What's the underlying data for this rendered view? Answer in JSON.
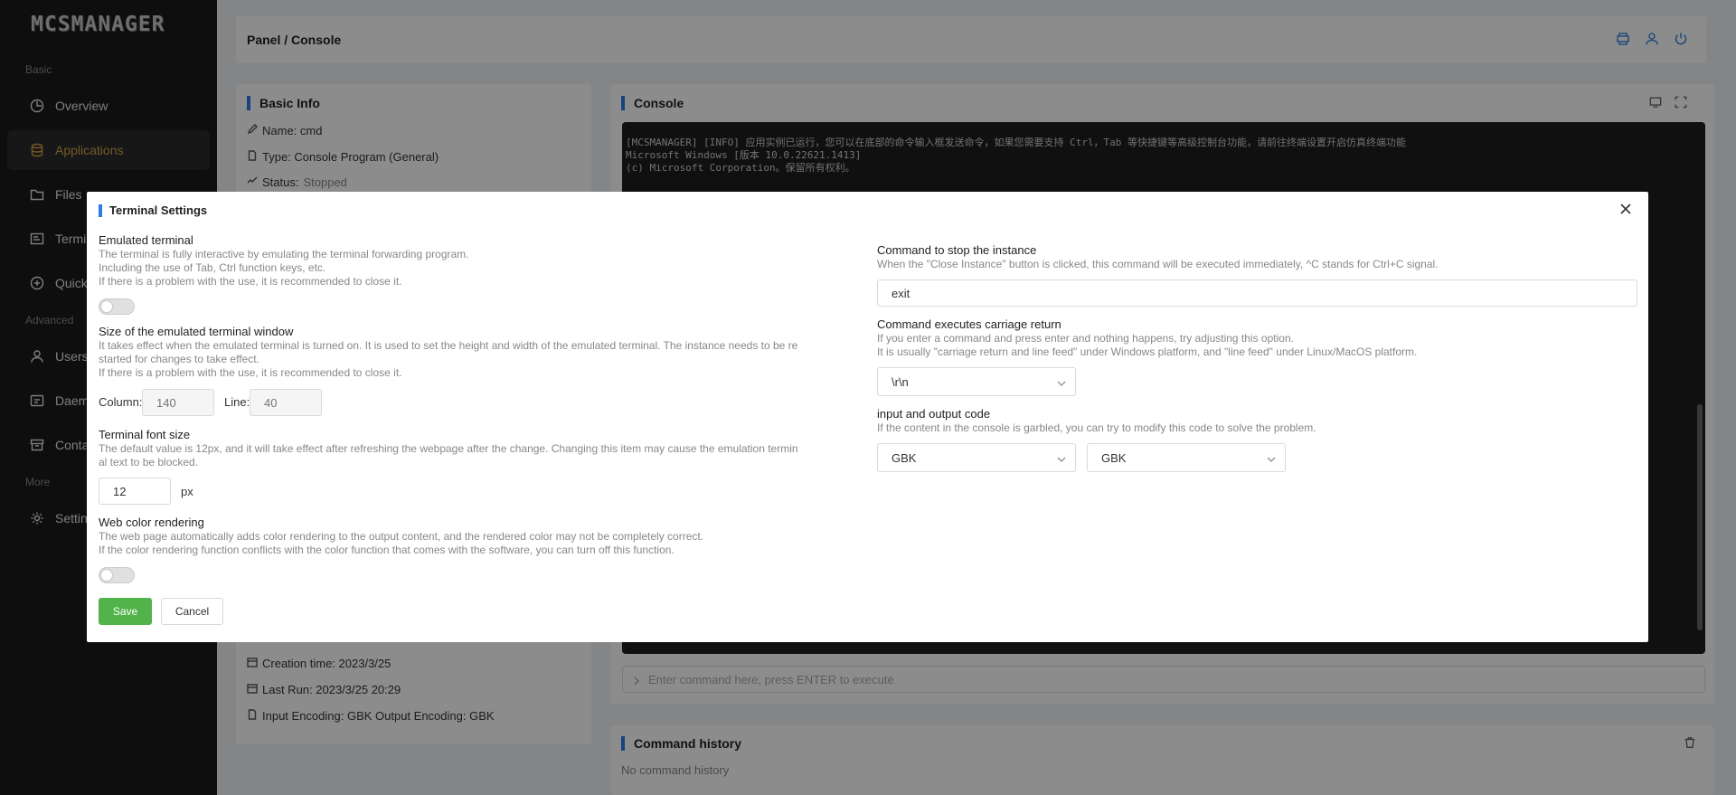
{
  "app": {
    "logo": "MCSMANAGER"
  },
  "sidebar": {
    "groups": [
      "Basic",
      "Advanced",
      "More"
    ],
    "items": [
      {
        "label": "Overview",
        "icon": "dashboard-icon"
      },
      {
        "label": "Applications",
        "icon": "database-icon",
        "active": true
      },
      {
        "label": "Files",
        "icon": "folder-icon"
      },
      {
        "label": "Termi",
        "icon": "terminal-icon"
      },
      {
        "label": "Quick",
        "icon": "plus-circle-icon"
      },
      {
        "label": "Users",
        "icon": "user-icon"
      },
      {
        "label": "Daem",
        "icon": "daemon-icon"
      },
      {
        "label": "Conta",
        "icon": "box-icon"
      },
      {
        "label": "Setting",
        "icon": "gear-icon"
      }
    ]
  },
  "header": {
    "breadcrumb": "Panel / Console"
  },
  "basic_info": {
    "title": "Basic Info",
    "name": "Name: cmd",
    "type": "Type: Console Program (General)",
    "status_label": "Status:",
    "status_value": "Stopped",
    "creation_time": "Creation time: 2023/3/25",
    "last_run": "Last Run: 2023/3/25 20:29",
    "encoding": "Input Encoding: GBK Output Encoding: GBK"
  },
  "console": {
    "title": "Console",
    "lines": [
      "[MCSMANAGER] [INFO] 应用实例已运行，您可以在底部的命令输入框发送命令，如果您需要支持 Ctrl，Tab 等快捷键等高级控制台功能，请前往终端设置开启仿真终端功能",
      "Microsoft Windows [版本 10.0.22621.1413]",
      "(c) Microsoft Corporation。保留所有权利。"
    ],
    "input_placeholder": "Enter command here, press ENTER to execute"
  },
  "command_history": {
    "title": "Command history",
    "empty": "No command history"
  },
  "modal": {
    "title": "Terminal Settings",
    "emulated": {
      "title": "Emulated terminal",
      "desc1": "The terminal is fully interactive by emulating the terminal forwarding program.",
      "desc2": "Including the use of Tab, Ctrl function keys, etc.",
      "desc3": "If there is a problem with the use, it is recommended to close it.",
      "enabled": false
    },
    "window_size": {
      "title": "Size of the emulated terminal window",
      "desc1": "It takes effect when the emulated terminal is turned on. It is used to set the height and width of the emulated terminal. The instance needs to be re",
      "desc2": "started for changes to take effect.",
      "desc3": "If there is a problem with the use, it is recommended to close it.",
      "column_label": "Column:",
      "column_placeholder": "140",
      "line_label": "Line:",
      "line_placeholder": "40"
    },
    "font_size": {
      "title": "Terminal font size",
      "desc1": "The default value is 12px, and it will take effect after refreshing the webpage after the change. Changing this item may cause the emulation termin",
      "desc2": "al text to be blocked.",
      "value": "12",
      "unit": "px"
    },
    "color_rendering": {
      "title": "Web color rendering",
      "desc1": "The web page automatically adds color rendering to the output content, and the rendered color may not be completely correct.",
      "desc2": "If the color rendering function conflicts with the color function that comes with the software, you can turn off this function.",
      "enabled": false
    },
    "stop_command": {
      "title": "Command to stop the instance",
      "desc": "When the \"Close Instance\" button is clicked, this command will be executed immediately, ^C stands for Ctrl+C signal.",
      "value": "exit"
    },
    "carriage_return": {
      "title": "Command executes carriage return",
      "desc1": "If you enter a command and press enter and nothing happens, try adjusting this option.",
      "desc2": "It is usually \"carriage return and line feed\" under Windows platform, and \"line feed\" under Linux/MacOS platform.",
      "value": "\\r\\n"
    },
    "io_code": {
      "title": "input and output code",
      "desc": "If the content in the console is garbled, you can try to modify this code to solve the problem.",
      "input_value": "GBK",
      "output_value": "GBK"
    },
    "save_label": "Save",
    "cancel_label": "Cancel"
  },
  "colors": {
    "accent": "#2f7be5",
    "save": "#52b34a",
    "active_nav": "#d4a24a"
  }
}
